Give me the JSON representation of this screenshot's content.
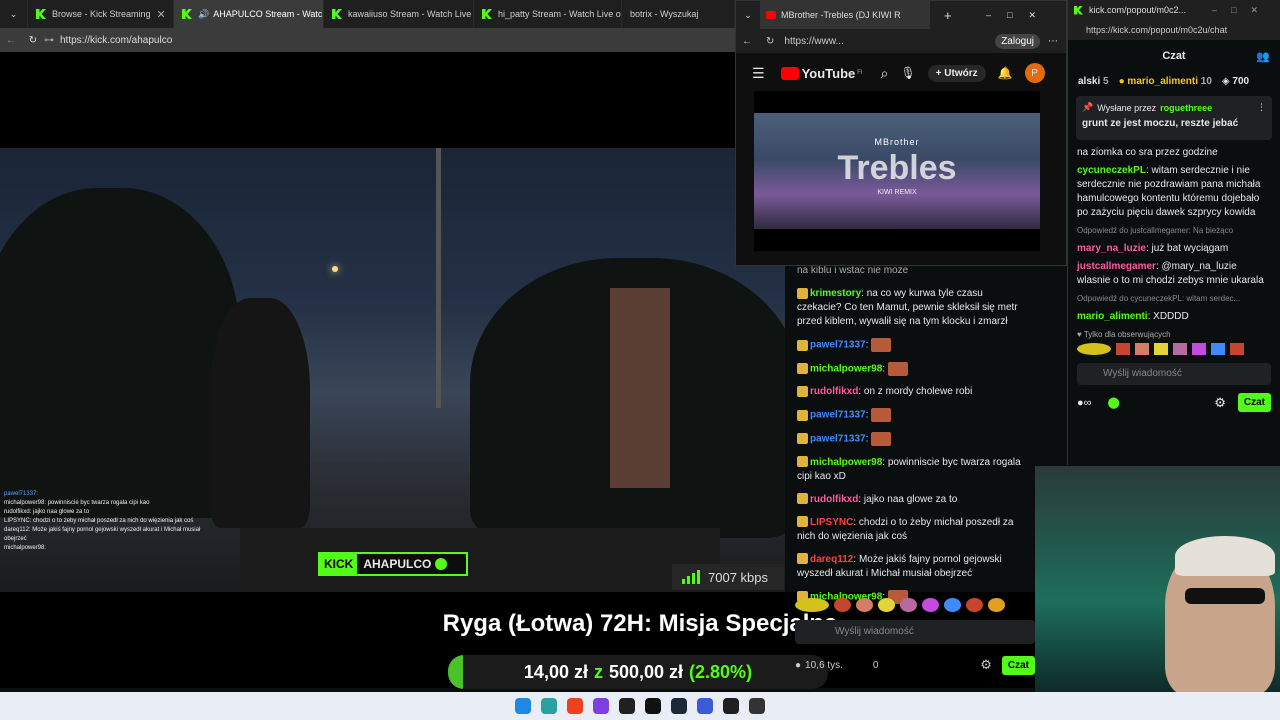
{
  "main_browser": {
    "tabs": [
      {
        "label": "Browse - Kick Streaming",
        "active": false
      },
      {
        "label": "AHAPULCO Stream - Watch",
        "active": true
      },
      {
        "label": "kawaiiuso Stream - Watch Live",
        "active": false
      },
      {
        "label": "hi_patty Stream - Watch Live o",
        "active": false
      },
      {
        "label": "botrix - Wyszukaj",
        "active": false
      }
    ],
    "url": "https://kick.com/ahapulco"
  },
  "video": {
    "overlay_chat": [
      "pawel71337:",
      "michalpower98: powinniscie byc twarza rogala cipi kao",
      "rudolfikxd: jajko naa glowe za to",
      "LIPSYNC: chodzi o to żeby michał poszedł za nich do więzienia jak coś",
      "dareq112: Może jakiś fajny pornol gejowski wyszedł akurat i Michał musiał obejrzeć",
      "michalpower98:"
    ],
    "kick_badge": "AHAPULCO",
    "kick_logo": "KICK",
    "bitrate": "7007 kbps"
  },
  "stream_title": "Ryga (Łotwa) 72H: Misja Specjalna",
  "donation": {
    "current": "14,00 zł",
    "sep": "z",
    "goal": "500,00 zł",
    "percent": "(2.80%)",
    "fraction": 0.028
  },
  "stream_chat": {
    "partial": "na kiblu i wstac nie moze",
    "messages": [
      {
        "user": "krimestory",
        "text": "na co wy kurwa tyle czasu czekacie? Co ten Mamut, pewnie skleksił się metr przed kiblem, wywalił się na tym klocku i zmarzł",
        "color": "#53fc18"
      },
      {
        "user": "pawel71337",
        "text": "",
        "color": "#3d8bff"
      },
      {
        "user": "michalpower98",
        "text": "",
        "color": "#53fc18"
      },
      {
        "user": "rudolfikxd",
        "text": "on z mordy cholewe robi",
        "color": "#ff5aa0"
      },
      {
        "user": "pawel71337",
        "text": "",
        "color": "#3d8bff"
      },
      {
        "user": "pawel71337",
        "text": "",
        "color": "#3d8bff"
      },
      {
        "user": "michalpower98",
        "text": "powinniscie byc twarza rogala cipi kao xD",
        "color": "#53fc18"
      },
      {
        "user": "rudolfikxd",
        "text": "jajko naa glowe za to",
        "color": "#ff5aa0"
      },
      {
        "user": "LIPSYNC",
        "text": "chodzi o to żeby michał poszedł za nich do więzienia jak coś",
        "color": "#ff4040"
      },
      {
        "user": "dareq112",
        "text": "Może jakiś fajny pornol gejowski wyszedł akurat i Michał musiał obejrzeć",
        "color": "#ff4040"
      },
      {
        "user": "michalpower98",
        "text": "",
        "color": "#53fc18"
      }
    ],
    "input_placeholder": "Wyślij wiadomość",
    "viewers": "10,6 tys.",
    "count": "0",
    "chat_button": "Czat"
  },
  "youtube": {
    "tab_title": "MBrother -Trebles (DJ KIWI R",
    "url": "https://www...",
    "login": "Zaloguj",
    "logo": "YouTube",
    "region": "FI",
    "create": "Utwórz",
    "avatar_letter": "P",
    "video_title": "MBrother",
    "video_big": "Trebles",
    "video_sub": "KIWI REMIX"
  },
  "popout": {
    "tab_url": "kick.com/popout/m0c2...",
    "url": "https://kick.com/popout/m0c2u/chat",
    "header": "Czat",
    "leaderboard": [
      {
        "name": "alski",
        "count": "5"
      },
      {
        "name": "mario_alimenti",
        "count": "10"
      },
      {
        "name": "",
        "count": "700"
      }
    ],
    "pinned_by_label": "Wysłane przez",
    "pinned_user": "roguethreee",
    "pinned_text": "grunt ze jest moczu, reszte jebać",
    "messages": [
      {
        "user": "",
        "text": "na ziomka co sra przez godzine"
      },
      {
        "user": "cycuneczekPL",
        "text": "witam serdecznie i nie serdecznie nie pozdrawiam pana michała hamulcowego kontentu któremu dojebało po zażyciu pięciu dawek szprycy kowida",
        "color": "#53fc18"
      },
      {
        "user": "mary_na_luzie",
        "text": "już bat wyciągam",
        "color": "#ff5aa0",
        "reply": "Odpowiedź do justcallmegamer: Na bieżąco"
      },
      {
        "user": "justcallmegamer",
        "text": "@mary_na_luzie wlasnie o to mi chodzi zebys mnie ukarala",
        "color": "#ff5aa0"
      },
      {
        "user": "mario_alimenti",
        "text": "XDDDD",
        "color": "#53fc18",
        "reply": "Odpowiedź do cycuneczekPL: witam serdec..."
      }
    ],
    "followers_only": "Tylko dla obserwujących",
    "input_placeholder": "Wyślij wiadomość",
    "chat_button": "Czat"
  }
}
